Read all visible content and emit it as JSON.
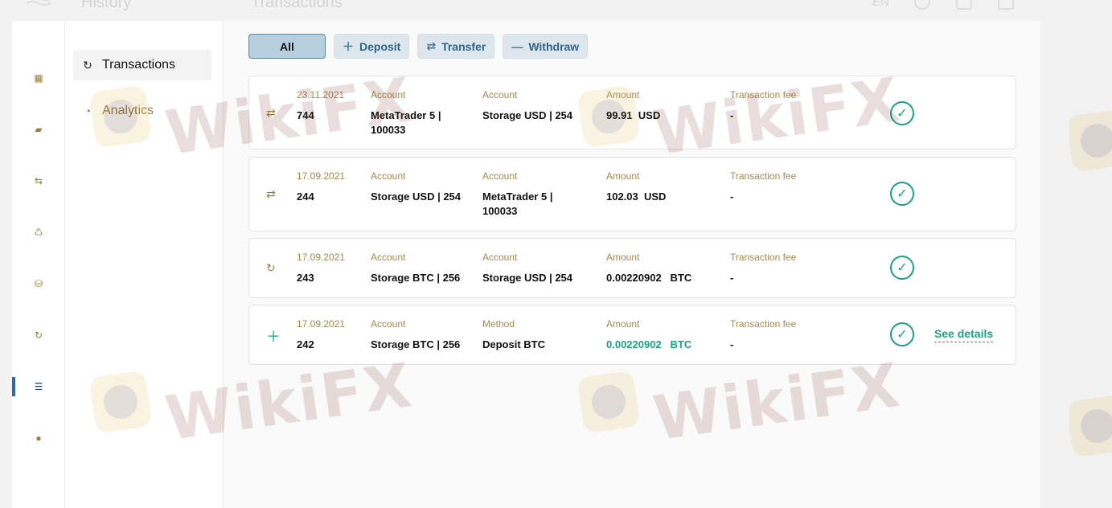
{
  "header": {
    "page_title": "History",
    "section_title": "Transactions",
    "language": "EN"
  },
  "rail": {
    "items": [
      {
        "name": "dashboard-icon",
        "glyph": "▦"
      },
      {
        "name": "wallet-icon",
        "glyph": "▰"
      },
      {
        "name": "transfer-icon",
        "glyph": "⇆"
      },
      {
        "name": "recycle-icon",
        "glyph": "♺"
      },
      {
        "name": "lock-icon",
        "glyph": "⛁"
      },
      {
        "name": "exchange-icon",
        "glyph": "↻"
      },
      {
        "name": "list-icon",
        "glyph": "☰"
      },
      {
        "name": "user-icon",
        "glyph": "●"
      }
    ],
    "active_index": 6
  },
  "subnav": {
    "items": [
      {
        "label": "Transactions",
        "icon": "refresh-icon",
        "glyph": "↻"
      },
      {
        "label": "Analytics",
        "icon": "pie-chart-icon",
        "glyph": "◔"
      }
    ]
  },
  "filters": {
    "all": "All",
    "deposit": "Deposit",
    "transfer": "Transfer",
    "withdraw": "Withdraw"
  },
  "transactions": [
    {
      "type_icon": "transfer-icon",
      "date": "23.11.2021",
      "id": "744",
      "from_label": "Account",
      "from_value": "MetaTrader 5 | 100033",
      "to_label": "Account",
      "to_value": "Storage USD | 254",
      "amount_label": "Amount",
      "amount": "99.91",
      "currency": "USD",
      "fee_label": "Transaction fee",
      "fee": "-"
    },
    {
      "type_icon": "transfer-icon",
      "date": "17.09.2021",
      "id": "244",
      "from_label": "Account",
      "from_value": "Storage USD | 254",
      "to_label": "Account",
      "to_value": "MetaTrader 5 | 100033",
      "amount_label": "Amount",
      "amount": "102.03",
      "currency": "USD",
      "fee_label": "Transaction fee",
      "fee": "-"
    },
    {
      "type_icon": "exchange-icon",
      "date": "17.09.2021",
      "id": "243",
      "from_label": "Account",
      "from_value": "Storage BTC | 256",
      "to_label": "Account",
      "to_value": "Storage USD | 254",
      "amount_label": "Amount",
      "amount": "0.00220902",
      "currency": "BTC",
      "fee_label": "Transaction fee",
      "fee": "-"
    },
    {
      "type_icon": "plus-icon",
      "date": "17.09.2021",
      "id": "242",
      "from_label": "Account",
      "from_value": "Storage BTC | 256",
      "to_label": "Method",
      "to_value": "Deposit BTC",
      "amount_label": "Amount",
      "amount": "0.00220902",
      "currency": "BTC",
      "fee_label": "Transaction fee",
      "fee": "-",
      "details_link": "See details"
    }
  ],
  "watermark": "WikiFX",
  "colors": {
    "accent_gold": "#9a7f3c",
    "accent_blue": "#2e6688",
    "success_green": "#1aa383"
  }
}
